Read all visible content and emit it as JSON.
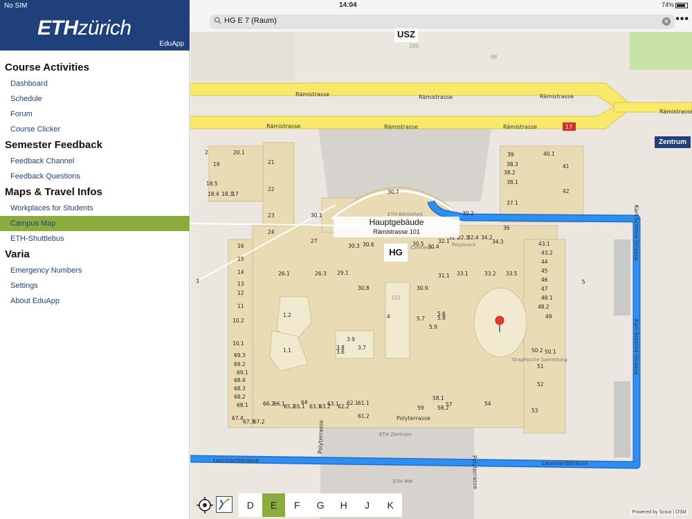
{
  "sidebar": {
    "carrier": "No SIM",
    "logo_bold": "ETH",
    "logo_light": "zürich",
    "app_name": "EduApp",
    "sections": [
      {
        "title": "Course Activities",
        "items": [
          "Dashboard",
          "Schedule",
          "Forum",
          "Course Clicker"
        ]
      },
      {
        "title": "Semester Feedback",
        "items": [
          "Feedback Channel",
          "Feedback Questions"
        ]
      },
      {
        "title": "Maps & Travel Infos",
        "items": [
          "Workplaces for Students",
          "Campus Map",
          "ETH-Shuttlebus"
        ]
      },
      {
        "title": "Varia",
        "items": [
          "Emergency Numbers",
          "Settings",
          "About EduApp"
        ]
      }
    ],
    "active_item": "Campus Map"
  },
  "status": {
    "time": "14:04",
    "battery": "74%"
  },
  "search": {
    "value": "HG E 7 (Raum)"
  },
  "map": {
    "building_title": "Hauptgebäude",
    "building_address": "Rämistrasse 101",
    "building_code": "HG",
    "usz_label": "USZ",
    "zentrum_label": "Zentrum",
    "streets": {
      "raemistrasse": "Rämistrasse",
      "polyterrasse": "Polyterrasse",
      "leonhardstrasse": "Leonhardstrasse",
      "karl_schmid": "Karl-Schmid-Strasse"
    },
    "place_labels": [
      "ETH Zentrum",
      "ETH MM",
      "Graphische Sammlung",
      "ETH-Bibliothek",
      "Cafeteria",
      "Polysnack"
    ],
    "bus_number": "17",
    "marker_room": "7",
    "rooms": [
      "20.1",
      "19",
      "18.5",
      "18.4",
      "18.3",
      "17",
      "21",
      "22",
      "23",
      "24",
      "16",
      "15",
      "14",
      "13",
      "12",
      "11",
      "10.2",
      "10.1",
      "69.3",
      "69.2",
      "69.1",
      "68.4",
      "68.3",
      "68.2",
      "68.1",
      "67.4",
      "67.3",
      "67.2",
      "66.2",
      "66.1",
      "65.2",
      "65.1",
      "64",
      "63.3",
      "63.2",
      "63.1",
      "62.2",
      "62.1",
      "61.1",
      "61.2",
      "30.7",
      "30.1",
      "30.2",
      "30.3",
      "30.6",
      "30.5",
      "30.4",
      "30.8",
      "30.9",
      "27",
      "26.1",
      "26.3",
      "29.1",
      "32.1",
      "32.2",
      "32.3",
      "32.4",
      "33.1",
      "33.2",
      "33.3",
      "33.5",
      "34.2",
      "34.3",
      "36",
      "37.1",
      "38.1",
      "38.2",
      "38.3",
      "39",
      "40.1",
      "41",
      "42",
      "43.1",
      "43.2",
      "44",
      "45",
      "46",
      "47",
      "48.1",
      "48.2",
      "49",
      "50.1",
      "50.2",
      "51",
      "52",
      "53",
      "54",
      "57",
      "58.1",
      "58.2",
      "59",
      "31.1",
      "5",
      "5.6",
      "5.7",
      "5.8",
      "5.9",
      "4",
      "3.6",
      "3.7",
      "3.8",
      "3.9",
      "1.1",
      "1.2",
      "2",
      "101",
      "3",
      "98",
      "180"
    ],
    "attribution": "Powered by Scout | OSM"
  },
  "floors": [
    "D",
    "E",
    "F",
    "G",
    "H",
    "J",
    "K"
  ],
  "active_floor": "E",
  "colors": {
    "eth_blue": "#1f407a",
    "eth_green": "#8bad3f",
    "route_blue": "#2f8ef0",
    "building": "#e9dcb4",
    "road_yellow": "#f8e96a"
  }
}
